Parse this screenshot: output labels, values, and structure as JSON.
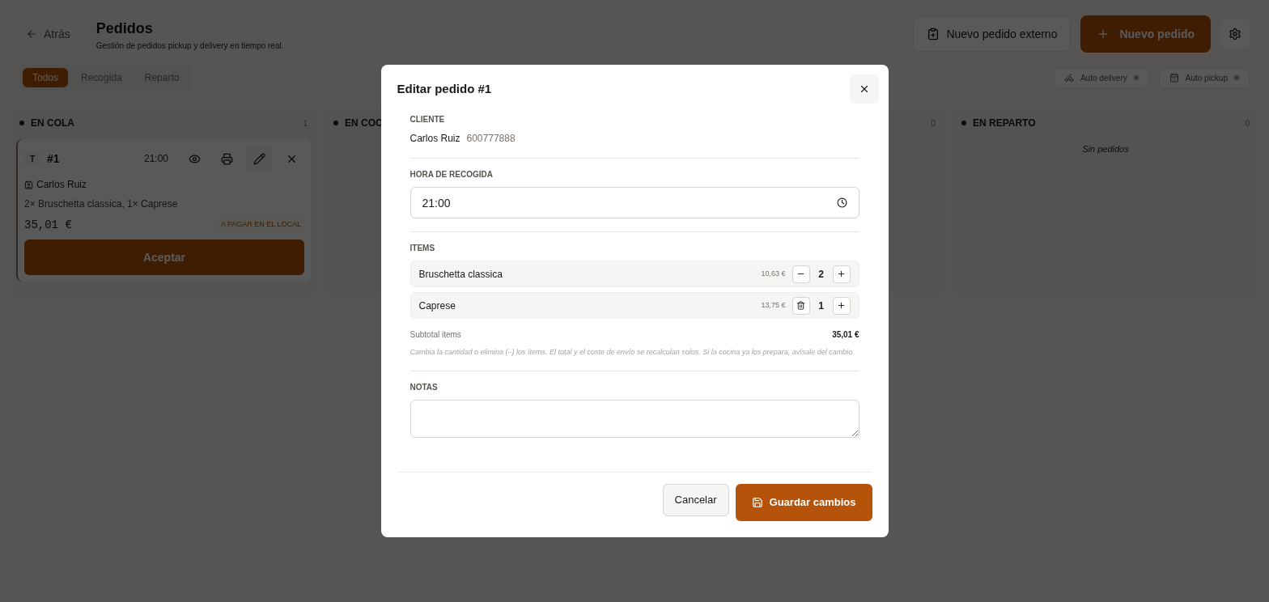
{
  "header": {
    "back": "Atrás",
    "title": "Pedidos",
    "subtitle": "Gestión de pedidos pickup y delivery en tiempo real.",
    "external_button": "Nuevo pedido externo",
    "new_button": "Nuevo pedido"
  },
  "tabs": [
    {
      "label": "Todos",
      "selected": true
    },
    {
      "label": "Recogida",
      "selected": false
    },
    {
      "label": "Reparto",
      "selected": false
    }
  ],
  "toggles": [
    {
      "kind": "delivery",
      "label": "Auto delivery"
    },
    {
      "kind": "pickup",
      "label": "Auto pickup"
    }
  ],
  "columns": [
    {
      "title": "EN COLA",
      "count": "1",
      "cards": [
        {
          "type": "T",
          "number": "#1",
          "time": "21:00",
          "customer": "Carlos Ruiz",
          "items": "2× Bruschetta classica, 1× Caprese",
          "total": "35,01 €",
          "payment": "A PAGAR EN EL LOCAL",
          "action": "Aceptar"
        }
      ]
    },
    {
      "title": "EN COC"
    },
    {
      "count": "0"
    },
    {
      "title": "EN REPARTO",
      "count": "0",
      "empty": "Sin pedidos"
    }
  ],
  "modal": {
    "title": "Editar pedido #1",
    "customer_label": "CLIENTE",
    "customer_name": "Carlos Ruiz",
    "customer_phone": "600777888",
    "time_label": "HORA DE RECOGIDA",
    "time_value": "21:00",
    "items_label": "ITEMS",
    "items": [
      {
        "kind": "decrement",
        "name": "Bruschetta classica",
        "price": "10,63 €",
        "qty": "2"
      },
      {
        "kind": "delete",
        "name": "Caprese",
        "price": "13,75 €",
        "qty": "1"
      }
    ],
    "subtotal_label": "Subtotal items",
    "subtotal": "35,01 €",
    "hint": "Cambia la cantidad o elimina (–) los ítems. El total y el coste de envío se recalculan solos. Si la cocina ya los prepara, avísale del cambio.",
    "notes_label": "NOTAS",
    "cancel": "Cancelar",
    "save": "Guardar cambios"
  }
}
